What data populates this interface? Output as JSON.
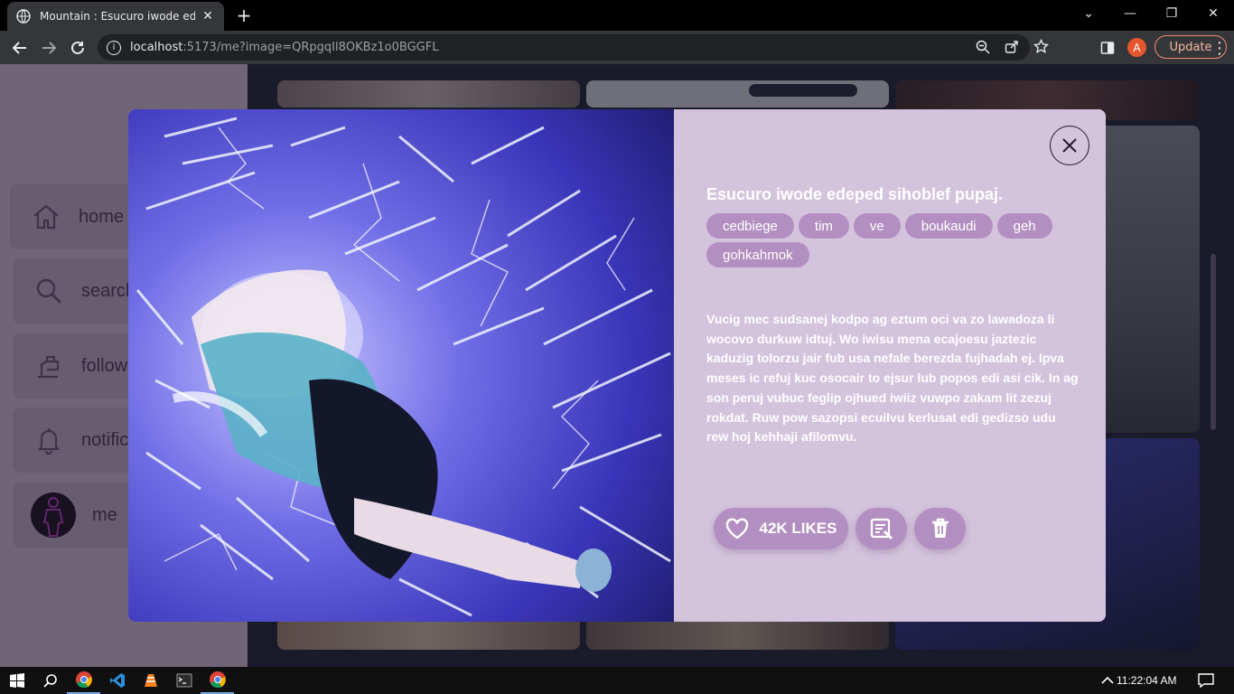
{
  "browser": {
    "tab_title": "Mountain : Esucuro iwode edeped sihoblef pupaj.",
    "url_host": "localhost",
    "url_rest": ":5173/me?image=QRpgqIl8OKBz1o0BGGFL",
    "profile_letter": "A",
    "update_label": "Update"
  },
  "sidebar": {
    "items": [
      {
        "label": "home",
        "icon": "home-icon"
      },
      {
        "label": "search",
        "icon": "search-icon"
      },
      {
        "label": "follow",
        "icon": "follow-icon"
      },
      {
        "label": "notifications",
        "icon": "bell-icon"
      },
      {
        "label": "me",
        "icon": "avatar"
      }
    ]
  },
  "modal": {
    "title": "Esucuro iwode edeped sihoblef pupaj.",
    "tags": [
      "cedbiege",
      "tim",
      "ve",
      "boukaudi",
      "geh",
      "gohkahmok"
    ],
    "description": "Vucig mec sudsanej kodpo ag eztum oci va zo lawadoza li wocovo durkuw idtuj. Wo iwisu mena ecajoesu jaztezic kaduzig tolorzu jair fub usa nefale berezda fujhadah ej. Ipva meses ic refuj kuc osocair to ejsur lub popos edi asi cik. In ag son peruj vubuc feglip ojhued iwiiz vuwpo zakam lit zezuj rokdat. Ruw pow sazopsi ecuilvu kerlusat edi gedizso udu rew hoj kehhaji afilomvu.",
    "likes_label": "42K LIKES",
    "accent_color": "#b38fc1",
    "panel_color": "#d4c3dd"
  },
  "taskbar": {
    "time": "11:22:04 AM"
  }
}
